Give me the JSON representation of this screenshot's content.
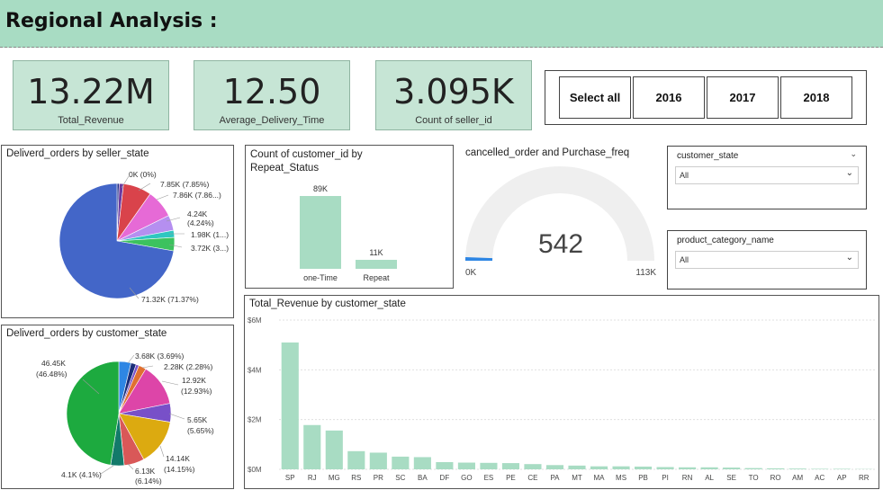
{
  "header": {
    "title": "Regional Analysis :"
  },
  "kpis": [
    {
      "value": "13.22M",
      "label": "Total_Revenue"
    },
    {
      "value": "12.50",
      "label": "Average_Delivery_Time"
    },
    {
      "value": "3.095K",
      "label": "Count of seller_id"
    }
  ],
  "year_slicer": {
    "buttons": [
      "Select all",
      "2016",
      "2017",
      "2018"
    ]
  },
  "seller_pie": {
    "title": "Deliverd_orders by seller_state",
    "labels": [
      "0K (0%)",
      "7.85K (7.85%)",
      "7.86K (7.86...)",
      "4.24K",
      "(4.24%)",
      "1.98K (1...)",
      "3.72K (3...)",
      "71.32K (71.37%)"
    ],
    "colors": {
      "main": "#4366c8",
      "red": "#d9434b",
      "pink": "#e66ad6",
      "lav": "#b58ff0",
      "teal": "#2ec7c0",
      "green": "#3cc25e",
      "purple": "#6a3aa0",
      "navy": "#1e2b85"
    }
  },
  "customer_pie": {
    "title": "Deliverd_orders by customer_state",
    "labels": [
      "46.45K",
      "(46.48%)",
      "3.68K (3.69%)",
      "2.28K (2.28%)",
      "12.92K",
      "(12.93%)",
      "5.65K",
      "(5.65%)",
      "14.14K",
      "(14.15%)",
      "6.13K",
      "(6.14%)",
      "4.1K (4.1%)"
    ],
    "colors": {
      "green": "#1daa3f",
      "gold": "#dcaa10",
      "magenta": "#dd45a8",
      "violet": "#7850c8",
      "coral": "#d95858",
      "teal": "#137a6a",
      "blue": "#2e86e4",
      "navy": "#1a2e7a",
      "orange": "#e07030"
    }
  },
  "repeat_chart": {
    "title_line1": "Count of customer_id by",
    "title_line2": "Repeat_Status",
    "color": "#a8dcc3",
    "bars": [
      {
        "label": "one-Time",
        "value_label": "89K",
        "value": 89
      },
      {
        "label": "Repeat",
        "value_label": "11K",
        "value": 11
      }
    ]
  },
  "gauge": {
    "title": "cancelled_order and Purchase_freq",
    "value_label": "542",
    "min_label": "0K",
    "max_label": "113K",
    "value": 542,
    "max": 113000
  },
  "filters": [
    {
      "title": "customer_state",
      "value": "All"
    },
    {
      "title": "product_category_name",
      "value": "All"
    }
  ],
  "chart_data": {
    "type": "bar",
    "title": "Total_Revenue by customer_state",
    "categories": [
      "SP",
      "RJ",
      "MG",
      "RS",
      "PR",
      "SC",
      "BA",
      "DF",
      "GO",
      "ES",
      "PE",
      "CE",
      "PA",
      "MT",
      "MA",
      "MS",
      "PB",
      "PI",
      "RN",
      "AL",
      "SE",
      "TO",
      "RO",
      "AM",
      "AC",
      "AP",
      "RR"
    ],
    "values": [
      5.1,
      1.78,
      1.56,
      0.73,
      0.67,
      0.51,
      0.49,
      0.29,
      0.27,
      0.26,
      0.25,
      0.21,
      0.17,
      0.15,
      0.12,
      0.12,
      0.11,
      0.09,
      0.08,
      0.08,
      0.07,
      0.05,
      0.04,
      0.03,
      0.02,
      0.02,
      0.01
    ],
    "ylim": [
      0,
      6
    ],
    "yticks": [
      "$0M",
      "$2M",
      "$4M",
      "$6M"
    ],
    "color": "#a8dcc3"
  }
}
